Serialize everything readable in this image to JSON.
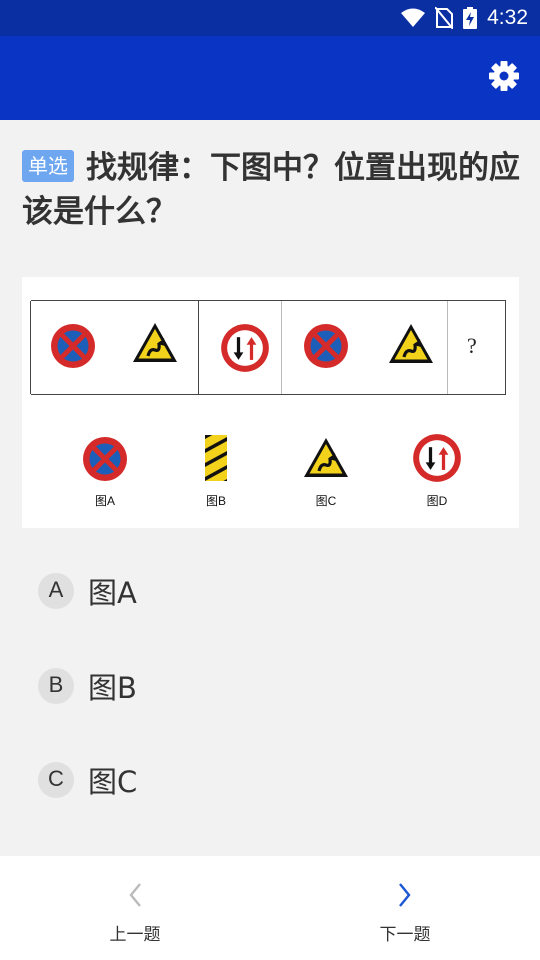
{
  "status_bar": {
    "time": "4:32",
    "icons": [
      "wifi-icon",
      "no-sim-icon",
      "battery-charging-icon"
    ]
  },
  "app_bar": {
    "settings_icon": "gear-icon",
    "color": "#0a34c3"
  },
  "question": {
    "tag": "单选",
    "text": "找规律：下图中？位置出现的应该是什么？"
  },
  "figure": {
    "sequence": [
      "no-parking-sign",
      "winding-road-sign",
      "two-way-traffic-sign",
      "no-parking-sign",
      "winding-road-sign",
      "?"
    ],
    "question_mark": "?",
    "choices": [
      {
        "label": "图A",
        "sign": "no-parking-sign"
      },
      {
        "label": "图B",
        "sign": "hazard-marker-sign"
      },
      {
        "label": "图C",
        "sign": "winding-road-sign"
      },
      {
        "label": "图D",
        "sign": "two-way-traffic-sign"
      }
    ]
  },
  "options": [
    {
      "letter": "A",
      "text": "图A"
    },
    {
      "letter": "B",
      "text": "图B"
    },
    {
      "letter": "C",
      "text": "图C"
    }
  ],
  "bottom_nav": {
    "prev_label": "上一题",
    "next_label": "下一题",
    "prev_color": "#bbbbbb",
    "next_color": "#1a56d6"
  }
}
